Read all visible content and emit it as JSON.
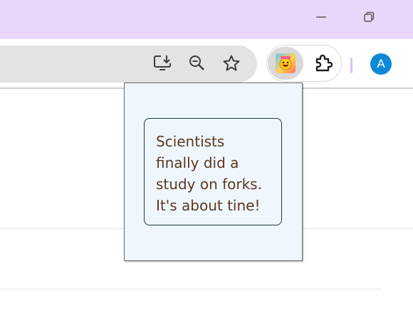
{
  "window": {
    "minimize_icon": "minimize-icon",
    "restore_icon": "restore-icon",
    "titlebar_color": "#e9d7fb"
  },
  "toolbar": {
    "install_icon": "install-app-icon",
    "zoom_icon": "zoom-out-icon",
    "bookmark_icon": "star-icon",
    "extension_icon": "joke-extension-icon",
    "extensions_menu_icon": "puzzle-icon",
    "profile_initial": "A",
    "profile_color": "#0b88d8"
  },
  "popup": {
    "joke": "Scientists finally did a study on forks. It's about tine!",
    "background": "#eff6fe",
    "text_color": "#5a3a1e"
  }
}
